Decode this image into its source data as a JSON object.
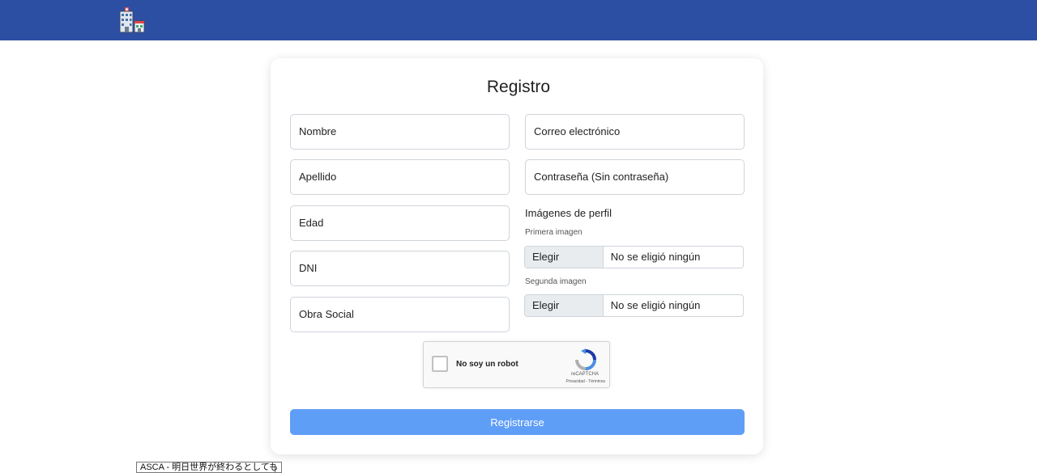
{
  "form": {
    "title": "Registro",
    "fields_left": [
      {
        "placeholder": "Nombre"
      },
      {
        "placeholder": "Apellido"
      },
      {
        "placeholder": "Edad"
      },
      {
        "placeholder": "DNI"
      },
      {
        "placeholder": "Obra Social"
      }
    ],
    "fields_right": [
      {
        "placeholder": "Correo electrónico"
      },
      {
        "placeholder": "Contraseña (Sin contraseña)"
      }
    ],
    "profile_images": {
      "label": "Imágenes de perfil",
      "first_label": "Primera imagen",
      "second_label": "Segunda imagen",
      "choose_button": "Elegir archivo",
      "no_file_text": "No se eligió ningún archivo"
    },
    "captcha": {
      "checkbox_label": "No soy un robot",
      "brand": "reCAPTCHA",
      "links": "Privacidad - Términos"
    },
    "submit_label": "Registrarse"
  },
  "taskbar": {
    "item_label": "ASCA - 明日世界が終わるとしても"
  },
  "colors": {
    "navbar": "#2c4fa3",
    "submit": "#5f9ef7"
  }
}
